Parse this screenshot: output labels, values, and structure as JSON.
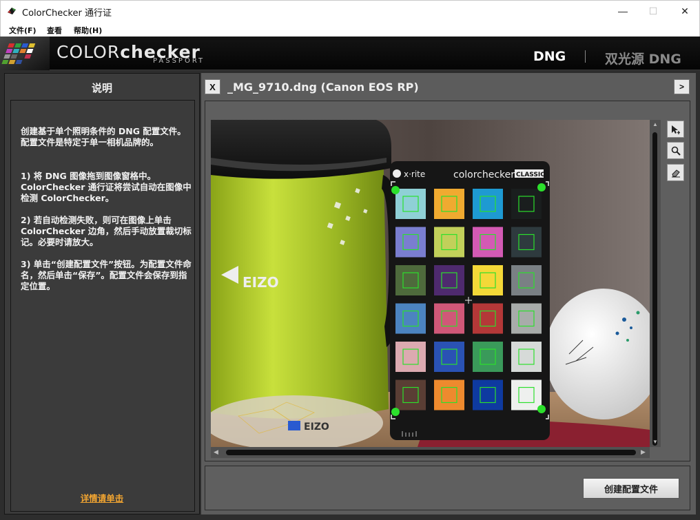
{
  "window": {
    "title": "ColorChecker 通行证",
    "minimize": "—",
    "maximize": "☐",
    "close": "✕"
  },
  "menu": {
    "file": "文件(F)",
    "view": "查看",
    "help": "帮助(H)"
  },
  "brand": {
    "wordmark_light": "COLOR",
    "wordmark_bold": "checker",
    "subtitle": "PASSPORT"
  },
  "modes": {
    "dng": "DNG",
    "dual": "双光源 DNG"
  },
  "instructions": {
    "title": "说明",
    "para1": "创建基于单个照明条件的 DNG 配置文件。配置文件是特定于单一相机品牌的。",
    "para2": "1) 将 DNG 图像拖到图像窗格中。ColorChecker 通行证将尝试自动在图像中检测 ColorChecker。",
    "para3": "2) 若自动检测失败，则可在图像上单击 ColorChecker 边角，然后手动放置裁切标记。必要时请放大。",
    "para4": "3) 单击“创建配置文件”按钮。为配置文件命名，然后单击“保存”。配置文件会保存到指定位置。",
    "details_link": "详情请单击"
  },
  "viewer": {
    "close_button": "X",
    "file_title": "_MG_9710.dng (Canon EOS RP)",
    "expand_button": ">",
    "tools": [
      "select-tool-icon",
      "zoom-icon",
      "eraser-icon"
    ]
  },
  "photo_text": {
    "xrite": "x·rite",
    "colorchecker": "colorchecker",
    "classic": "CLASSIC",
    "mug_brand": "EIZO",
    "coaster_brand": "EIZO"
  },
  "chart_patches": [
    "#8fd0d6",
    "#f0aa30",
    "#1e9ad2",
    "#1a1e1e",
    "#7a7ed0",
    "#c2d05a",
    "#d45ab4",
    "#2e3a3e",
    "#4e6a3c",
    "#4e2a6e",
    "#f4d838",
    "#7a8084",
    "#4c84c0",
    "#d05878",
    "#b43838",
    "#a8acaa",
    "#dcaab0",
    "#2a52b4",
    "#3a9a5a",
    "#d6dad8",
    "#5a3e34",
    "#ee8a2e",
    "#0e3aa0",
    "#eef0ee"
  ],
  "actions": {
    "create_profile": "创建配置文件"
  }
}
